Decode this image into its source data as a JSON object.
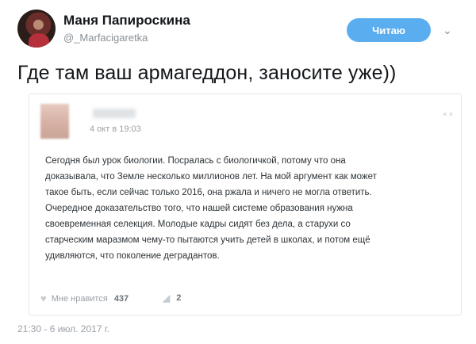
{
  "author": {
    "name": "Маня Папироскина",
    "handle": "@_Marfacigaretka"
  },
  "follow_button": {
    "label": "Читаю"
  },
  "tweet": {
    "text": "Где там ваш армагеддон, заносите уже))",
    "timestamp": "21:30 - 6 июл. 2017 г."
  },
  "quoted_post": {
    "date": "4 окт в 19:03",
    "close_glyph": "× ×",
    "body_lines": [
      "Сегодня был урок биологии. Посралась с биологичкой, потому что она",
      "доказывала, что Земле несколько миллионов лет. На мой аргумент как может",
      "такое быть, если сейчас только 2016, она ржала и ничего не могла ответить.",
      "Очередное доказательство того, что нашей системе образования нужна",
      "своевременная селекция. Молодые кадры сидят без дела, а старухи со",
      "старческим маразмом чему-то пытаются учить детей в школах, и потом ещё",
      "удивляются, что поколение деградантов."
    ],
    "like_label": "Мне нравится",
    "like_count": "437",
    "comment_count": "2"
  },
  "icons": {
    "chevron": "chevron-down-icon",
    "heart": "heart-icon",
    "comment": "megaphone-icon"
  },
  "colors": {
    "follow_button_bg": "#5aaef0",
    "muted_text": "#9aa0a6",
    "border": "#e1e8ed"
  }
}
